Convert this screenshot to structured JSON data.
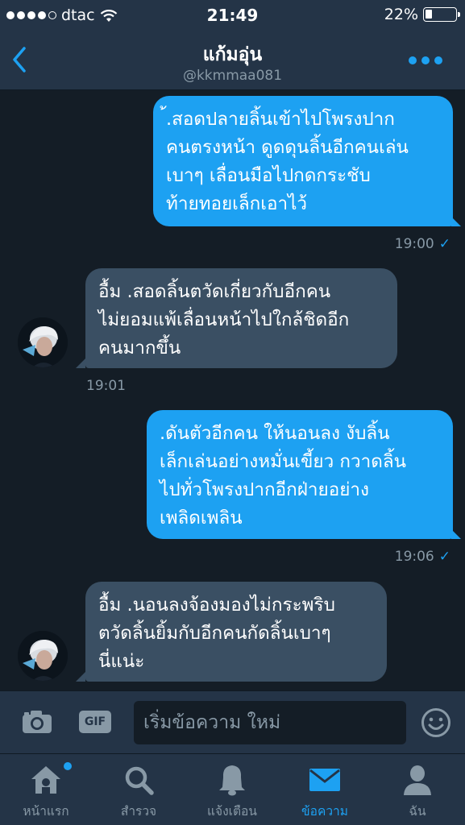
{
  "status_bar": {
    "carrier": "dtac",
    "time": "21:49",
    "battery_percent_label": "22%",
    "battery_level": 0.22
  },
  "header": {
    "title": "แก้มอุ่น",
    "handle": "@kkmmaa081"
  },
  "messages": [
    {
      "direction": "out",
      "lines": [
        "้.สอดปลายลิ้นเข้าไปโพรงปาก",
        "คนตรงหน้า ดูดดุนลิ้นอีกคนเล่น",
        "เบาๆ เลื่อนมือไปกดกระชับ",
        "ท้ายทอยเล็กเอาไว้"
      ],
      "time": "19:00",
      "read": true
    },
    {
      "direction": "in",
      "lines": [
        "อื้ม .สอดลิ้นตวัดเกี่ยวกับอีกคน",
        "ไม่ยอมแพ้เลื่อนหน้าไปใกล้ชิดอีก",
        "คนมากขึ้น"
      ],
      "time": "19:01"
    },
    {
      "direction": "out",
      "lines": [
        ".ดันตัวอีกคน ให้นอนลง งับลิ้น",
        "เล็กเล่นอย่างหมั่นเขี้ยว กวาดลิ้น",
        "ไปทั่วโพรงปากอีกฝ่ายอย่าง",
        "เพลิดเพลิน"
      ],
      "time": "19:06",
      "read": true
    },
    {
      "direction": "in",
      "lines": [
        "อื้ม .นอนลงจ้องมองไม่กระพริบ",
        "ตวัดลิ้นยิ้มกับอีกคนกัดลิ้นเบาๆ",
        "นี่แน่ะ"
      ]
    }
  ],
  "composer": {
    "gif_label": "GIF",
    "placeholder": "เริ่มข้อความ ใหม่"
  },
  "tabs": [
    {
      "label": "หน้าแรก",
      "icon": "home-icon",
      "has_notification": true
    },
    {
      "label": "สำรวจ",
      "icon": "search-icon"
    },
    {
      "label": "แจ้งเตือน",
      "icon": "bell-icon"
    },
    {
      "label": "ข้อความ",
      "icon": "envelope-icon",
      "active": true
    },
    {
      "label": "ฉัน",
      "icon": "person-icon"
    }
  ],
  "colors": {
    "accent": "#1da1f2",
    "background": "#141d26",
    "bar": "#243447",
    "incoming_bubble": "#3a4f63",
    "muted_text": "#8899a6"
  }
}
